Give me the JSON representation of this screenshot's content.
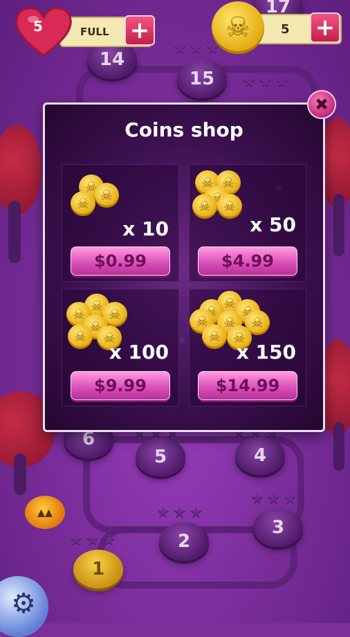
{
  "hud": {
    "lives_count": "5",
    "lives_status": "FULL",
    "coins_count": "5",
    "plus_glyph": "+"
  },
  "map": {
    "levels": [
      "1",
      "2",
      "3",
      "4",
      "5",
      "6",
      "14",
      "15",
      "17"
    ]
  },
  "shop": {
    "title": "Coins shop",
    "close_glyph": "✖",
    "items": [
      {
        "quantity": "x 10",
        "price": "$0.99"
      },
      {
        "quantity": "x 50",
        "price": "$4.99"
      },
      {
        "quantity": "x 100",
        "price": "$9.99"
      },
      {
        "quantity": "x 150",
        "price": "$14.99"
      }
    ]
  },
  "icons": {
    "skull": "☠",
    "gear": "⚙",
    "star": "★",
    "pumpkin": "▴▴"
  },
  "colors": {
    "background": "#7b2f9a",
    "price_button": "#d84cb5",
    "plus_button": "#c51f4b",
    "coin": "#e6a90b"
  }
}
